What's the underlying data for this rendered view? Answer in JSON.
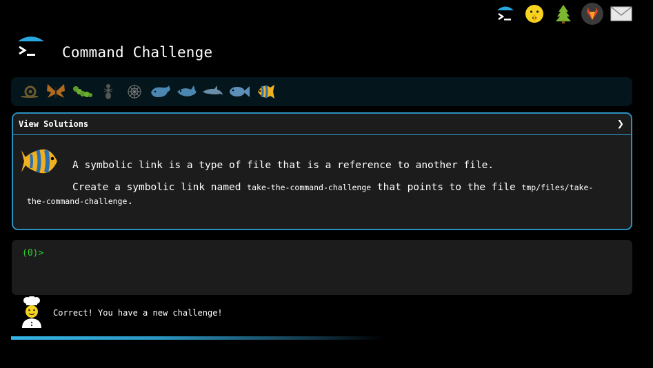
{
  "app": {
    "title": "Command Challenge"
  },
  "top_icons": [
    "terminal-logo-icon",
    "shushing-face-icon",
    "evergreen-tree-icon",
    "gitlab-fox-icon",
    "envelope-icon"
  ],
  "levels": [
    {
      "name": "snail-icon",
      "color": "#6b5a2e"
    },
    {
      "name": "butterfly-icon",
      "color": "#b06a1e"
    },
    {
      "name": "caterpillar-icon",
      "color": "#5c9a2a"
    },
    {
      "name": "ant-icon",
      "color": "#555555"
    },
    {
      "name": "spider-web-icon",
      "color": "#777777"
    },
    {
      "name": "whale-icon",
      "color": "#4a86b0"
    },
    {
      "name": "shark-icon",
      "color": "#4a86b0"
    },
    {
      "name": "dolphin-icon",
      "color": "#6a8ea8"
    },
    {
      "name": "fish-icon",
      "color": "#5b8fb8"
    },
    {
      "name": "tropical-fish-icon",
      "color": "#f0b020"
    }
  ],
  "challenge": {
    "view_solutions_label": "View Solutions",
    "chevron": "❯",
    "line1": "A symbolic link is a type of file that is a reference to another file.",
    "line2_pre": "Create a symbolic link named ",
    "line2_code1": "take-the-command-challenge",
    "line2_mid": " that points to the file ",
    "line2_code2": "tmp/files/take-the-command-challenge",
    "line2_post": "."
  },
  "terminal": {
    "prompt": "(0)>"
  },
  "status": {
    "message": "Correct! You have a new challenge!"
  },
  "progress": {
    "fraction": 0.6
  },
  "colors": {
    "accent": "#2b8fbf",
    "prompt": "#2fd12f",
    "panel": "#1c1c1c"
  }
}
